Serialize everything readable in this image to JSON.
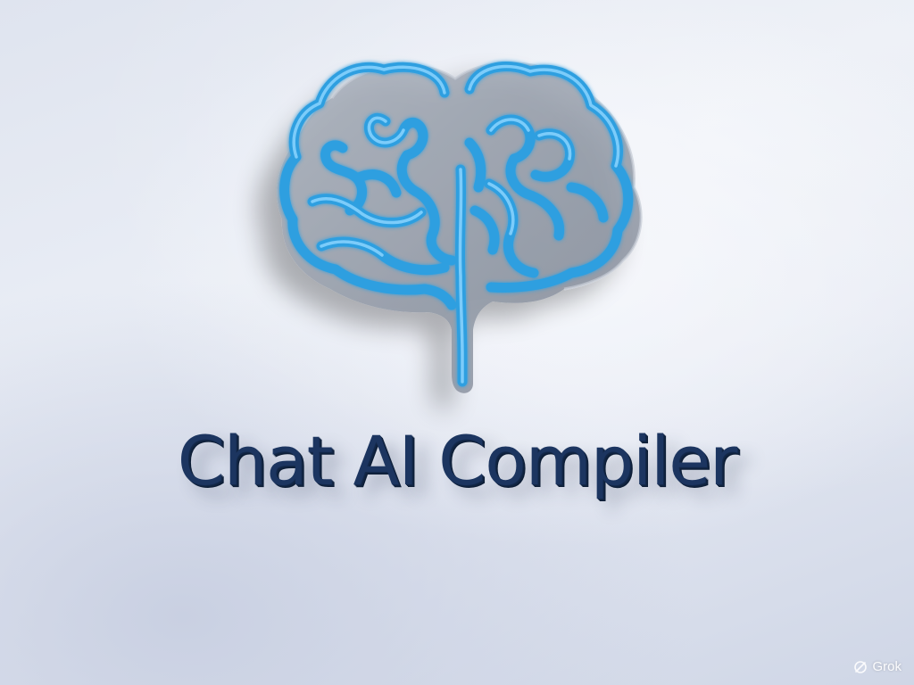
{
  "logo": {
    "icon": "brain-icon",
    "colors": {
      "neon_blue": "#2f9fe0",
      "neon_highlight": "#8ad4ff",
      "backplate": "#9aa2ae"
    }
  },
  "title": {
    "text": "Chat AI Compiler",
    "color": "#1c3560"
  },
  "watermark": {
    "icon": "grok-logo-icon",
    "text": "Grok"
  },
  "background": {
    "color": "#e4e8f2"
  }
}
